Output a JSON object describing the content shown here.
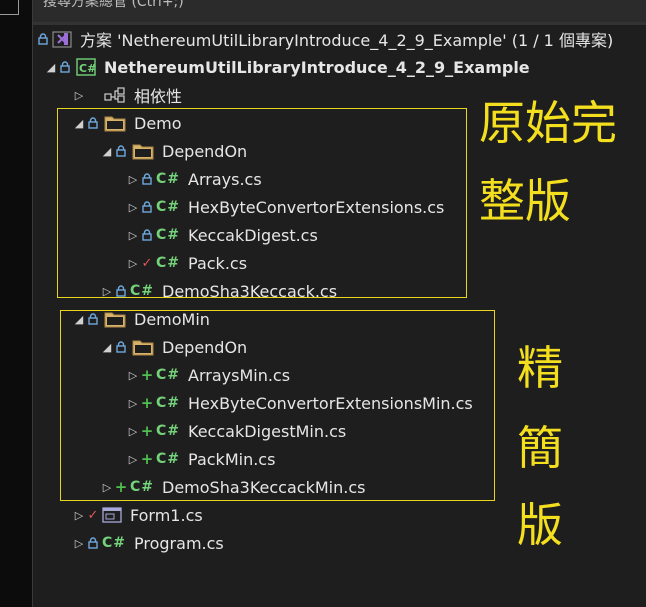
{
  "search": {
    "placeholder": "搜尋方案總管 (Ctrl+;)"
  },
  "tree": {
    "solution": "方案 'NethereumUtilLibraryIntroduce_4_2_9_Example' (1 / 1 個專案)",
    "project": "NethereumUtilLibraryIntroduce_4_2_9_Example",
    "dependencies": "相依性",
    "demo": {
      "folder": "Demo",
      "dependon": "DependOn",
      "files": [
        "Arrays.cs",
        "HexByteConvertorExtensions.cs",
        "KeccakDigest.cs",
        "Pack.cs"
      ],
      "sha": "DemoSha3Keccack.cs"
    },
    "demomin": {
      "folder": "DemoMin",
      "dependon": "DependOn",
      "files": [
        "ArraysMin.cs",
        "HexByteConvertorExtensionsMin.cs",
        "KeccakDigestMin.cs",
        "PackMin.cs"
      ],
      "sha": "DemoSha3KeccackMin.cs"
    },
    "form1": "Form1.cs",
    "program": "Program.cs"
  },
  "annotations": {
    "original_line1": "原始完",
    "original_line2": "整版",
    "lite_1": "精",
    "lite_2": "簡",
    "lite_3": "版"
  },
  "icons": {
    "lock": "lock-icon",
    "folder": "folder-icon",
    "csharp": "csharp-file-icon",
    "solution": "visual-studio-solution-icon",
    "dependencies": "dependencies-icon",
    "form": "form-icon"
  },
  "colors": {
    "annotation": "#f4df1f",
    "csharp": "#74d27a",
    "check": "#e05757",
    "add": "#4fbf4f"
  }
}
